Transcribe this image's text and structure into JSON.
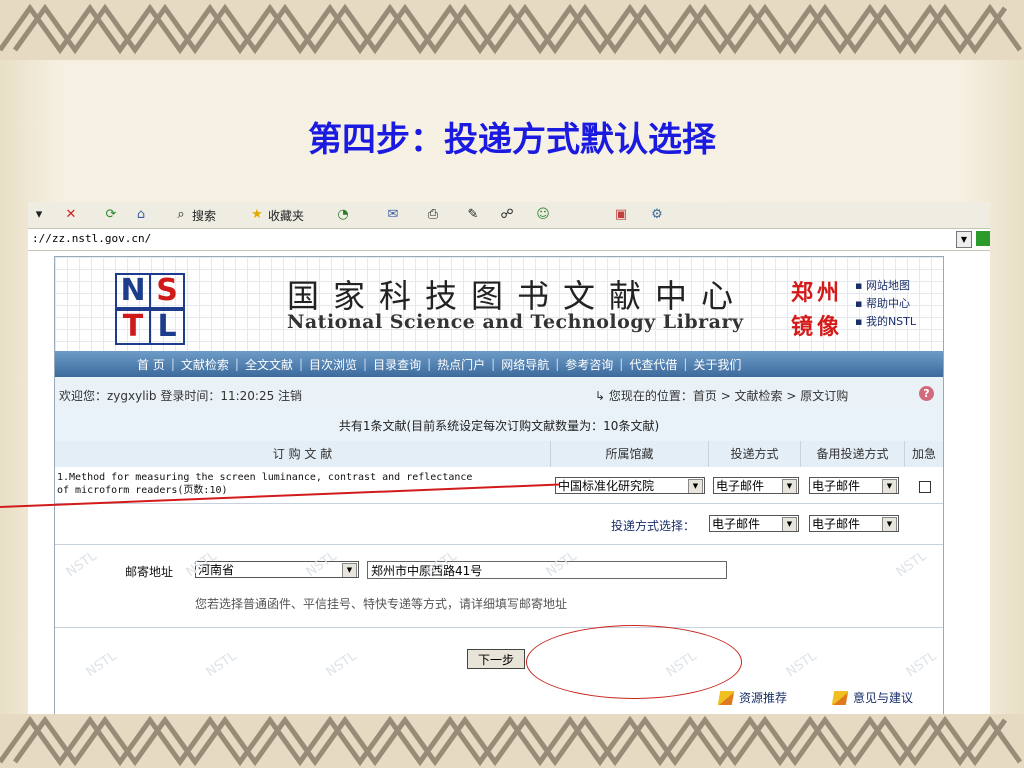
{
  "slide_title": "第四步：投递方式默认选择",
  "browser": {
    "toolbar": {
      "search_label": "搜索",
      "favorites_label": "收藏夹"
    },
    "address": "://zz.nstl.gov.cn/"
  },
  "header": {
    "logo_letters": [
      "N",
      "S",
      "T",
      "L"
    ],
    "name_cn": "国家科技图书文献中心",
    "name_en": "National Science and Technology Library",
    "mirror_line1": "郑州",
    "mirror_line2": "镜像",
    "quick_links": [
      "网站地图",
      "帮助中心",
      "我的NSTL"
    ]
  },
  "nav": [
    "首 页",
    "文献检索",
    "全文文献",
    "目次浏览",
    "目录查询",
    "热点门户",
    "网络导航",
    "参考咨询",
    "代查代借",
    "关于我们"
  ],
  "status": {
    "welcome": "欢迎您：zygxylib 登录时间：11:20:25 注销",
    "location": "您现在的位置：首页 > 文献检索 > 原文订购",
    "help": "?"
  },
  "summary": "共有1条文献(目前系统设定每次订购文献数量为：10条文献)",
  "table": {
    "headers": [
      "订 购 文 献",
      "所属馆藏",
      "投递方式",
      "备用投递方式",
      "加急"
    ],
    "rows": [
      {
        "title_line1": "1.Method for measuring the screen luminance, contrast and reflectance",
        "title_line2": "of microform readers(页数:10)",
        "collection": "中国标准化研究院",
        "delivery": "电子邮件",
        "backup_delivery": "电子邮件"
      }
    ]
  },
  "default_delivery": {
    "label": "投递方式选择：",
    "delivery": "电子邮件",
    "backup_delivery": "电子邮件"
  },
  "postal": {
    "label": "邮寄地址",
    "province": "河南省",
    "address": "郑州市中原西路41号",
    "hint": "您若选择普通函件、平信挂号、特快专递等方式，请详细填写邮寄地址"
  },
  "next_button": "下一步",
  "footer_links": [
    "资源推荐",
    "意见与建议"
  ],
  "watermark": "NSTL",
  "colors": {
    "title": "#1a1ae0",
    "nav": "#3b6a9c",
    "mirror": "#d51a1a",
    "annotation": "#d21b1b"
  }
}
